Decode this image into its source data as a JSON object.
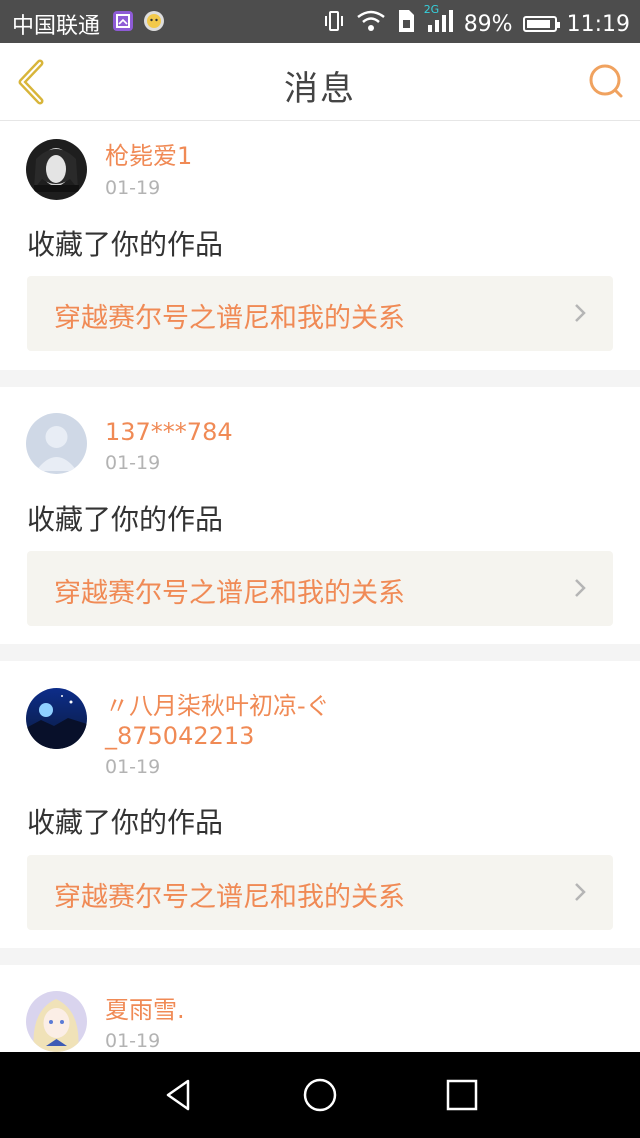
{
  "status_bar": {
    "carrier": "中国联通",
    "network": "2G",
    "battery": "89%",
    "battery_level": 0.89,
    "time": "11:19",
    "icons": [
      "gallery-app-icon",
      "face-app-icon",
      "vibrate-icon",
      "wifi-icon",
      "sim-icon",
      "signal-icon",
      "battery-icon"
    ]
  },
  "header": {
    "title": "消息",
    "back_icon": "chevron-left-icon",
    "search_icon": "search-icon",
    "accent": "#f0a25f"
  },
  "messages": [
    {
      "username": "枪毙爱1",
      "username_line2": "",
      "date": "01-19",
      "action": "收藏了你的作品",
      "work_title": "穿越赛尔号之谱尼和我的关系",
      "avatar": "dark-portrait-avatar"
    },
    {
      "username": "137***784",
      "username_line2": "",
      "date": "01-19",
      "action": "收藏了你的作品",
      "work_title": "穿越赛尔号之谱尼和我的关系",
      "avatar": "default-user-avatar"
    },
    {
      "username": "〃八月柒秋叶初凉-ぐ",
      "username_line2": "_875042213",
      "date": "01-19",
      "action": "收藏了你的作品",
      "work_title": "穿越赛尔号之谱尼和我的关系",
      "avatar": "blue-night-avatar"
    },
    {
      "username": "夏雨雪.",
      "username_line2": "",
      "date": "01-19",
      "action": "",
      "work_title": "",
      "avatar": "anime-girl-avatar"
    }
  ],
  "colors": {
    "username": "#f08a55",
    "work_title": "#f08a55",
    "date": "#b3b3b3",
    "status_bar": "#4d4d4d"
  },
  "nav_keys": [
    "back-triangle-icon",
    "home-circle-icon",
    "recents-square-icon"
  ]
}
